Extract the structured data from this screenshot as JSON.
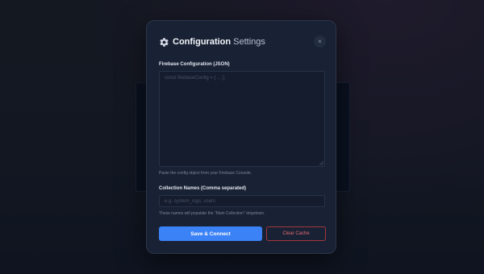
{
  "modal": {
    "title_bold": "Configuration",
    "title_light": "Settings",
    "close_label": "×",
    "icon": "gear-icon"
  },
  "firebase_config": {
    "label": "Firebase Configuration (JSON)",
    "placeholder": "const firebaseConfig = { ... };",
    "value": "",
    "hint": "Paste the config object from your Firebase Console."
  },
  "collections": {
    "label": "Collection Names (Comma separated)",
    "placeholder": "e.g. system_logs, users",
    "value": "",
    "hint": "These names will populate the \"Main Collection\" dropdown."
  },
  "actions": {
    "save_label": "Save & Connect",
    "clear_label": "Clear Cache"
  },
  "colors": {
    "primary": "#3b82f6",
    "danger": "#e26b73",
    "surface": "#192234"
  }
}
